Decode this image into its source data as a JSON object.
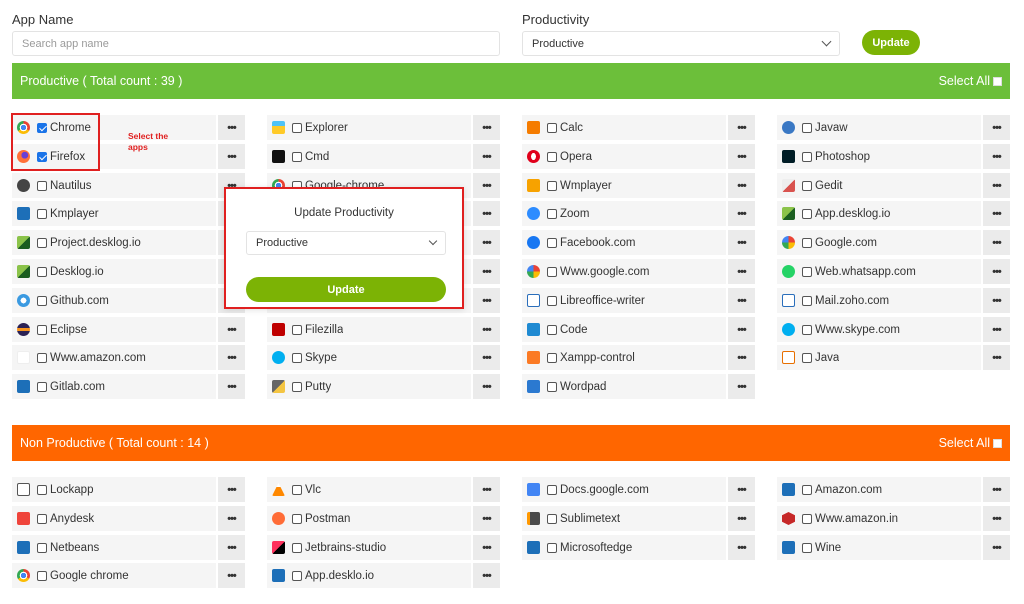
{
  "filters": {
    "app_name_label": "App Name",
    "search_placeholder": "Search app name",
    "productivity_label": "Productivity",
    "productivity_value": "Productive",
    "update_label": "Update"
  },
  "productive": {
    "title": "Productive ( Total count : 39 )",
    "select_all": "Select All",
    "color": "#6cbf3a",
    "columns": [
      [
        {
          "name": "Chrome",
          "icon": "chrome-icon",
          "checked": true
        },
        {
          "name": "Firefox",
          "icon": "firefox-icon",
          "checked": true
        },
        {
          "name": "Nautilus",
          "icon": "nautilus-icon",
          "checked": false
        },
        {
          "name": "Kmplayer",
          "icon": "puzzle-icon",
          "checked": false
        },
        {
          "name": "Project.desklog.io",
          "icon": "desklog-icon",
          "checked": false
        },
        {
          "name": "Desklog.io",
          "icon": "desklog-icon",
          "checked": false
        },
        {
          "name": "Github.com",
          "icon": "github-icon",
          "checked": false
        },
        {
          "name": "Eclipse",
          "icon": "eclipse-icon",
          "checked": false
        },
        {
          "name": "Www.amazon.com",
          "icon": "amazon-icon",
          "checked": false
        },
        {
          "name": "Gitlab.com",
          "icon": "puzzle-icon",
          "checked": false
        }
      ],
      [
        {
          "name": "Explorer",
          "icon": "folder-icon",
          "checked": false
        },
        {
          "name": "Cmd",
          "icon": "cmd-icon",
          "checked": false
        },
        {
          "name": "Google-chrome",
          "icon": "chrome-icon",
          "checked": false
        },
        {
          "name": "",
          "icon": "",
          "checked": false
        },
        {
          "name": "",
          "icon": "",
          "checked": false
        },
        {
          "name": "",
          "icon": "",
          "checked": false
        },
        {
          "name": "",
          "icon": "",
          "checked": false
        },
        {
          "name": "Filezilla",
          "icon": "filezilla-icon",
          "checked": false
        },
        {
          "name": "Skype",
          "icon": "skype-icon",
          "checked": false
        },
        {
          "name": "Putty",
          "icon": "putty-icon",
          "checked": false
        }
      ],
      [
        {
          "name": "Calc",
          "icon": "calc-icon",
          "checked": false
        },
        {
          "name": "Opera",
          "icon": "opera-icon",
          "checked": false
        },
        {
          "name": "Wmplayer",
          "icon": "wmplayer-icon",
          "checked": false
        },
        {
          "name": "Zoom",
          "icon": "zoom-icon",
          "checked": false
        },
        {
          "name": "Facebook.com",
          "icon": "facebook-icon",
          "checked": false
        },
        {
          "name": "Www.google.com",
          "icon": "google-icon",
          "checked": false
        },
        {
          "name": "Libreoffice-writer",
          "icon": "writer-icon",
          "checked": false
        },
        {
          "name": "Code",
          "icon": "vscode-icon",
          "checked": false
        },
        {
          "name": "Xampp-control",
          "icon": "xampp-icon",
          "checked": false
        },
        {
          "name": "Wordpad",
          "icon": "wordpad-icon",
          "checked": false
        }
      ],
      [
        {
          "name": "Javaw",
          "icon": "javaw-icon",
          "checked": false
        },
        {
          "name": "Photoshop",
          "icon": "photoshop-icon",
          "checked": false
        },
        {
          "name": "Gedit",
          "icon": "gedit-icon",
          "checked": false
        },
        {
          "name": "App.desklog.io",
          "icon": "desklog-icon",
          "checked": false
        },
        {
          "name": "Google.com",
          "icon": "google-icon",
          "checked": false
        },
        {
          "name": "Web.whatsapp.com",
          "icon": "whatsapp-icon",
          "checked": false
        },
        {
          "name": "Mail.zoho.com",
          "icon": "mail-icon",
          "checked": false
        },
        {
          "name": "Www.skype.com",
          "icon": "skype-icon",
          "checked": false
        },
        {
          "name": "Java",
          "icon": "java-icon",
          "checked": false
        }
      ]
    ]
  },
  "non_productive": {
    "title": "Non Productive ( Total count : 14 )",
    "select_all": "Select All",
    "color": "#ff6600",
    "columns": [
      [
        {
          "name": "Lockapp",
          "icon": "lock-icon",
          "checked": false
        },
        {
          "name": "Anydesk",
          "icon": "anydesk-icon",
          "checked": false
        },
        {
          "name": "Netbeans",
          "icon": "puzzle-icon",
          "checked": false
        },
        {
          "name": "Google chrome",
          "icon": "chrome-icon",
          "checked": false
        }
      ],
      [
        {
          "name": "Vlc",
          "icon": "vlc-icon",
          "checked": false
        },
        {
          "name": "Postman",
          "icon": "postman-icon",
          "checked": false
        },
        {
          "name": "Jetbrains-studio",
          "icon": "jetbrains-icon",
          "checked": false
        },
        {
          "name": "App.desklo.io",
          "icon": "puzzle-icon",
          "checked": false
        }
      ],
      [
        {
          "name": "Docs.google.com",
          "icon": "docs-icon",
          "checked": false
        },
        {
          "name": "Sublimetext",
          "icon": "sublime-icon",
          "checked": false
        },
        {
          "name": "Microsoftedge",
          "icon": "puzzle-icon",
          "checked": false
        }
      ],
      [
        {
          "name": "Amazon.com",
          "icon": "puzzle-icon",
          "checked": false
        },
        {
          "name": "Www.amazon.in",
          "icon": "amazon-in-icon",
          "checked": false
        },
        {
          "name": "Wine",
          "icon": "puzzle-icon",
          "checked": false
        }
      ]
    ]
  },
  "annotation": {
    "text": "Select the apps"
  },
  "modal": {
    "title": "Update Productivity",
    "select_value": "Productive",
    "update_label": "Update"
  },
  "more_label": "•••"
}
